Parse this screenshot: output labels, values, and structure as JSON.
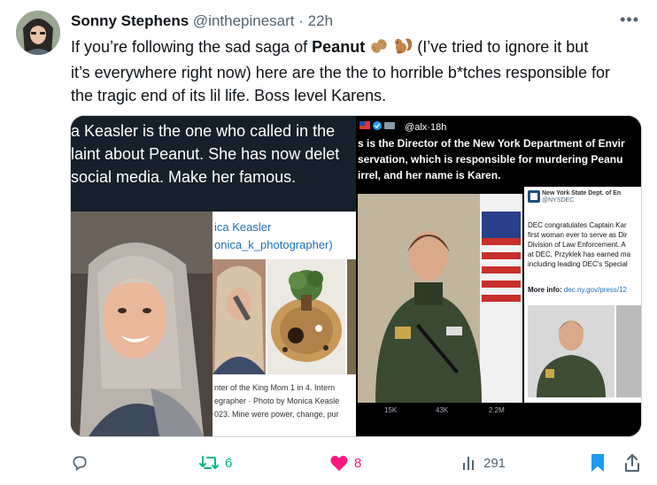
{
  "tweet": {
    "author_name": "Sonny Stephens",
    "handle": "@inthepinesart",
    "separator": "·",
    "time": "22h",
    "text_line1_pre": "If you’re following the sad saga of ",
    "text_line1_bold": "Peanut",
    "text_line1_post": " (I’ve tried to ignore it but",
    "text_line2": "it’s everywhere right now) here are the the to horrible b*tches responsible for",
    "text_line3": "the tragic end of its lil life. Boss level Karens.",
    "emojis": [
      "peanut-icon",
      "squirrel-icon"
    ]
  },
  "media": {
    "left": {
      "caption_lines": [
        "a Keasler is the one who called in the",
        "laint about Peanut. She has now delet",
        " social media. Make her famous."
      ],
      "profile_name": "ica Keasler",
      "profile_handle": "onica_k_photographer)",
      "profile_lines": [
        "nter of the King Mom 1 in 4. Intern",
        "egrapher · Photo by Monica Keasle",
        "023. Mine were power, change, pur"
      ]
    },
    "right": {
      "header_handle": "@alx·18h",
      "text_lines": [
        "s is the Director of the New York Department of Envir",
        "servation, which is responsible for murdering Peanu",
        "irrel, and her name is Karen."
      ],
      "card_org": "New York State Dept. of En",
      "card_handle": "@NYSDEC",
      "card_body_lines": [
        "DEC congratulates Captain Kar",
        "first woman ever to serve as Dir",
        "Division of Law Enforcement. A",
        "at DEC, Przyklek has earned ma",
        "including leading DEC's Special"
      ],
      "card_info_label": "More info: ",
      "card_info_link": "dec.ny.gov/press/12",
      "action_counts": [
        "15K",
        "43K",
        "2.2M"
      ]
    }
  },
  "actions": {
    "reply_count": "",
    "retweet_count": "6",
    "like_count": "8",
    "views_count": "291"
  },
  "colors": {
    "text": "#0f1419",
    "muted": "#536471",
    "retweet": "#00ba7c",
    "like": "#f91880",
    "bookmark": "#1d9bf0",
    "link": "#1d6fb8"
  }
}
